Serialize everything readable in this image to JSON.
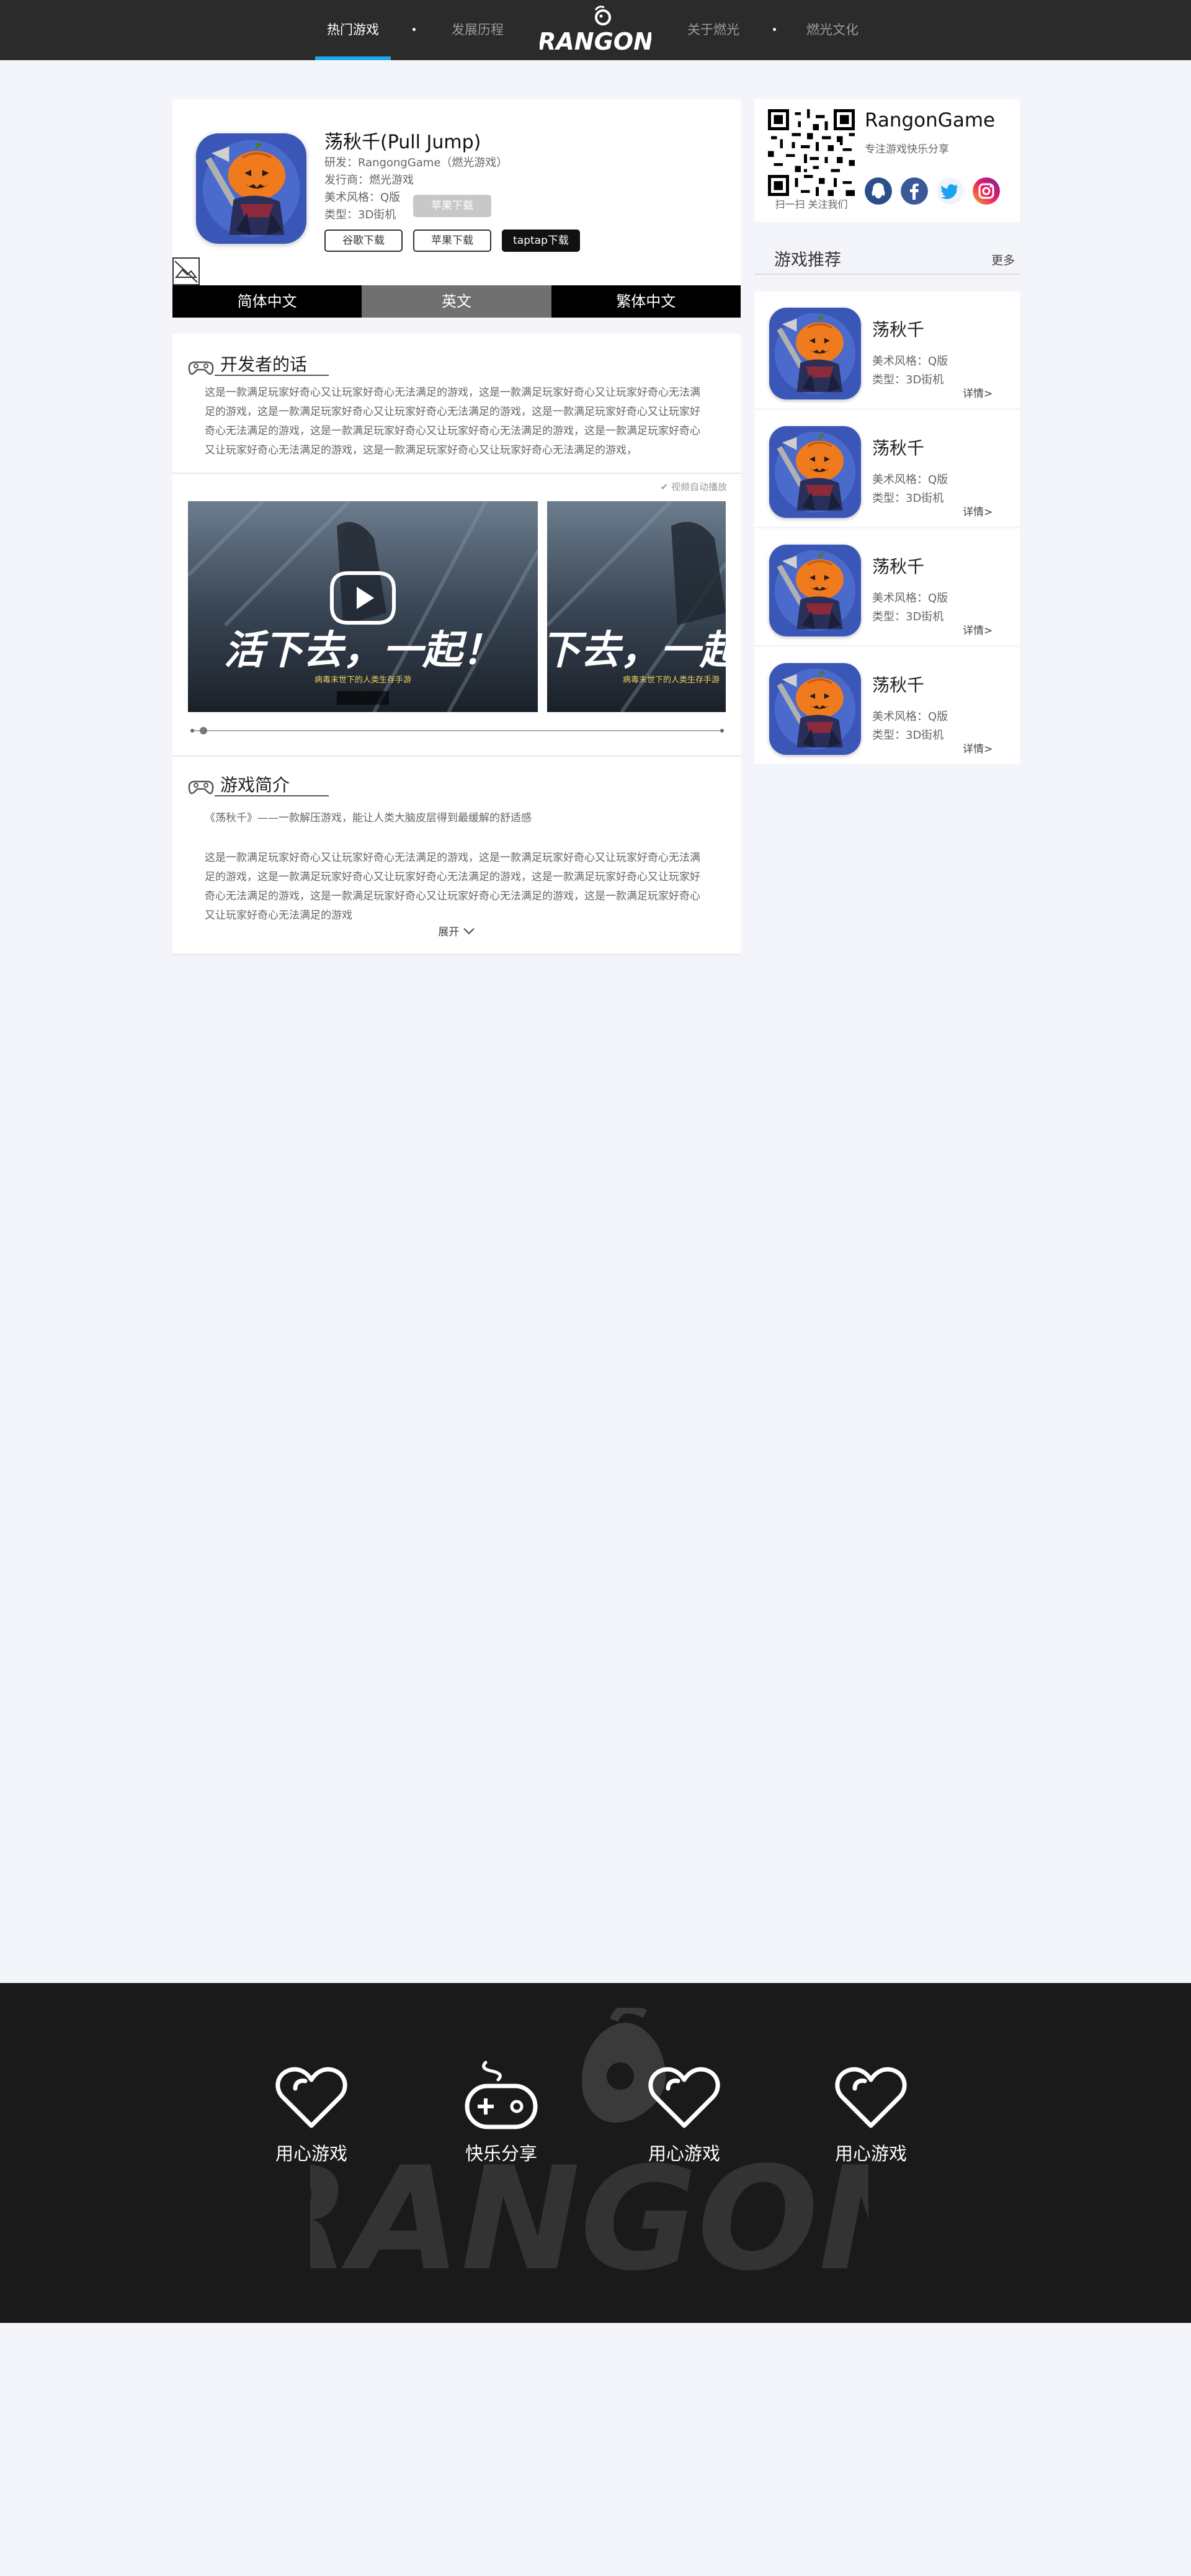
{
  "nav": {
    "items": [
      {
        "label": "热门游戏",
        "active": true
      },
      {
        "label": "发展历程",
        "active": false
      },
      {
        "label": "关于燃光",
        "active": false
      },
      {
        "label": "燃光文化",
        "active": false
      }
    ],
    "logo_text": "RANGON",
    "accent_color": "#1ea8f0"
  },
  "game": {
    "title": "荡秋千(Pull Jump)",
    "developer": "研发：RangongGame（燃光游戏）",
    "publisher": "发行商：燃光游戏",
    "art_style": "美术风格：Q版",
    "type": "类型：3D街机",
    "download_buttons": {
      "apple_disabled": "苹果下载",
      "google": "谷歌下载",
      "apple": "苹果下载",
      "taptap": "taptap下载"
    }
  },
  "languages": [
    {
      "label": "简体中文",
      "active": false
    },
    {
      "label": "英文",
      "active": true
    },
    {
      "label": "繁体中文",
      "active": false
    }
  ],
  "developer_words": {
    "heading": "开发者的话",
    "text": "这是一款满足玩家好奇心又让玩家好奇心无法满足的游戏，这是一款满足玩家好奇心又让玩家好奇心无法满足的游戏，这是一款满足玩家好奇心又让玩家好奇心无法满足的游戏，这是一款满足玩家好奇心又让玩家好奇心无法满足的游戏，这是一款满足玩家好奇心又让玩家好奇心无法满足的游戏，这是一款满足玩家好奇心又让玩家好奇心无法满足的游戏，这是一款满足玩家好奇心又让玩家好奇心无法满足的游戏，",
    "autoplay_label": "视频自动播放",
    "video": {
      "headline": "活下去，一起！",
      "tagline_left": "病毒末世下的人类生存手游",
      "tagline_right": "病毒末世下的人类生存手游"
    }
  },
  "game_intro": {
    "heading": "游戏简介",
    "lead": "《荡秋千》——一款解压游戏，能让人类大脑皮层得到最缓解的舒适感",
    "text": "这是一款满足玩家好奇心又让玩家好奇心无法满足的游戏，这是一款满足玩家好奇心又让玩家好奇心无法满足的游戏，这是一款满足玩家好奇心又让玩家好奇心无法满足的游戏，这是一款满足玩家好奇心又让玩家好奇心无法满足的游戏，这是一款满足玩家好奇心又让玩家好奇心无法满足的游戏，这是一款满足玩家好奇心又让玩家好奇心无法满足的游戏",
    "expand_label": "展开"
  },
  "sidebar": {
    "qr_caption": "扫一扫 关注我们",
    "brand": "RangonGame",
    "tagline": "专注游戏快乐分享",
    "social_icons": [
      "qq-icon",
      "facebook-icon",
      "twitter-icon",
      "instagram-icon"
    ],
    "recommend_title": "游戏推荐",
    "more_label": "更多",
    "recommendations": [
      {
        "name": "荡秋千",
        "art": "美术风格：Q版",
        "type": "类型：3D街机",
        "detail": "详情>"
      },
      {
        "name": "荡秋千",
        "art": "美术风格：Q版",
        "type": "类型：3D街机",
        "detail": "详情>"
      },
      {
        "name": "荡秋千",
        "art": "美术风格：Q版",
        "type": "类型：3D街机",
        "detail": "详情>"
      },
      {
        "name": "荡秋千",
        "art": "美术风格：Q版",
        "type": "类型：3D街机",
        "detail": "详情>"
      }
    ]
  },
  "footer": {
    "features": [
      {
        "label": "用心游戏",
        "icon": "heart-icon"
      },
      {
        "label": "快乐分享",
        "icon": "gamepad-icon"
      },
      {
        "label": "用心游戏",
        "icon": "heart-icon"
      },
      {
        "label": "用心游戏",
        "icon": "heart-icon"
      }
    ]
  }
}
